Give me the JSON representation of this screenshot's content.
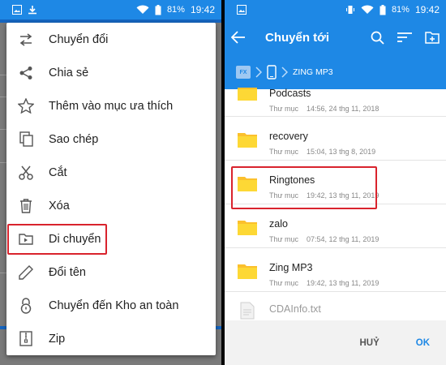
{
  "status": {
    "battery": "81%",
    "time": "19:42"
  },
  "left_menu": {
    "items": [
      {
        "label": "Chuyển đổi",
        "icon": "swap-icon"
      },
      {
        "label": "Chia sẻ",
        "icon": "share-icon"
      },
      {
        "label": "Thêm vào mục ưa thích",
        "icon": "star-icon"
      },
      {
        "label": "Sao chép",
        "icon": "copy-icon"
      },
      {
        "label": "Cắt",
        "icon": "scissors-icon"
      },
      {
        "label": "Xóa",
        "icon": "trash-icon"
      },
      {
        "label": "Di chuyển",
        "icon": "move-icon",
        "highlighted": true
      },
      {
        "label": "Đổi tên",
        "icon": "pencil-icon"
      },
      {
        "label": "Chuyển đến Kho an toàn",
        "icon": "lock-icon"
      },
      {
        "label": "Zip",
        "icon": "zip-icon"
      }
    ]
  },
  "right": {
    "title": "Chuyển tới",
    "breadcrumb": {
      "app_badge": "FX",
      "current": "ZING MP3"
    },
    "files": [
      {
        "name": "Podcasts",
        "kind": "Thư mục",
        "date": "14:56, 24 thg 11, 2018",
        "type": "folder"
      },
      {
        "name": "recovery",
        "kind": "Thư mục",
        "date": "15:04, 13 thg 8, 2019",
        "type": "folder"
      },
      {
        "name": "Ringtones",
        "kind": "Thư mục",
        "date": "19:42, 13 thg 11, 2019",
        "type": "folder",
        "highlighted": true
      },
      {
        "name": "zalo",
        "kind": "Thư mục",
        "date": "07:54, 12 thg 11, 2019",
        "type": "folder"
      },
      {
        "name": "Zing MP3",
        "kind": "Thư mục",
        "date": "19:42, 13 thg 11, 2019",
        "type": "folder"
      },
      {
        "name": "CDAInfo.txt",
        "kind": "",
        "date": "",
        "type": "file"
      }
    ],
    "cancel_label": "HUỶ",
    "ok_label": "OK"
  },
  "colors": {
    "accent": "#1e88e5",
    "highlight": "#d9232d",
    "folder": "#fbc02d"
  }
}
